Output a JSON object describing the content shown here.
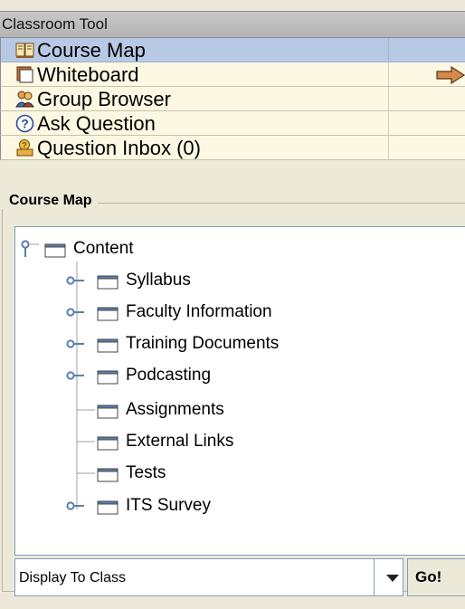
{
  "window": {
    "title": "Classroom Tool"
  },
  "menu": {
    "items": [
      {
        "label": "Course Map",
        "icon": "book-icon",
        "selected": true
      },
      {
        "label": "Whiteboard",
        "icon": "whiteboard-icon",
        "selected": false
      },
      {
        "label": "Group Browser",
        "icon": "group-icon",
        "selected": false
      },
      {
        "label": "Ask Question",
        "icon": "question-icon",
        "selected": false
      },
      {
        "label": "Question Inbox (0)",
        "icon": "inbox-icon",
        "selected": false
      }
    ],
    "arrow_icon": "right-arrow-icon"
  },
  "course_map": {
    "title": "Course Map",
    "tree": {
      "root": {
        "label": "Content",
        "expanded": true
      },
      "children": [
        {
          "label": "Syllabus",
          "expandable": true
        },
        {
          "label": "Faculty Information",
          "expandable": true
        },
        {
          "label": "Training Documents",
          "expandable": true
        },
        {
          "label": "Podcasting",
          "expandable": true
        },
        {
          "label": "Assignments",
          "expandable": false
        },
        {
          "label": "External Links",
          "expandable": false
        },
        {
          "label": "Tests",
          "expandable": false
        },
        {
          "label": "ITS Survey",
          "expandable": true
        }
      ]
    }
  },
  "controls": {
    "display_select": {
      "value": "Display To Class"
    },
    "go_button": "Go!"
  },
  "colors": {
    "selected_row": "#b7c9e4",
    "menu_row": "#fdf8e3",
    "panel_bg": "#ece9d8",
    "tree_handle": "#5a7fb0"
  }
}
